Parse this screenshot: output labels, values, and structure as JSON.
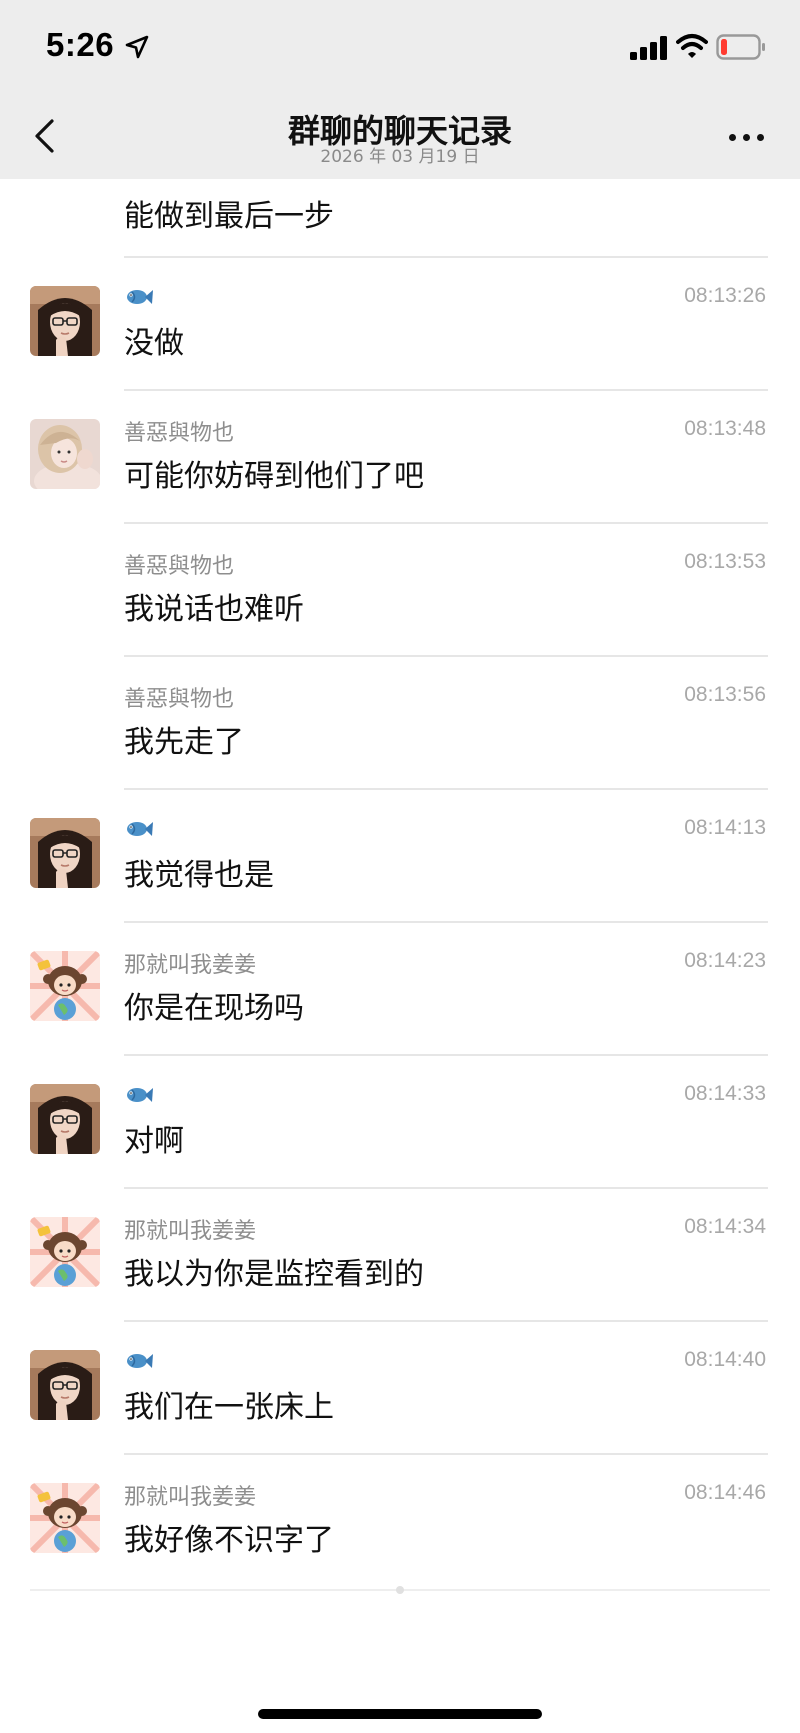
{
  "status_bar": {
    "time": "5:26"
  },
  "nav": {
    "title": "群聊的聊天记录",
    "date": "2026 年 03 月19 日"
  },
  "messages": [
    {
      "text": "能做到最后一步"
    },
    {
      "sender": "",
      "sender_icon": "fish-icon",
      "avatar": "glasses-girl-avatar",
      "time": "08:13:26",
      "text": "没做"
    },
    {
      "sender": "善惡與物也",
      "avatar": "blonde-girl-avatar",
      "time": "08:13:48",
      "text": "可能你妨碍到他们了吧"
    },
    {
      "sender": "善惡與物也",
      "time": "08:13:53",
      "text": "我说话也难听"
    },
    {
      "sender": "善惡與物也",
      "time": "08:13:56",
      "text": "我先走了"
    },
    {
      "sender": "",
      "sender_icon": "fish-icon",
      "avatar": "glasses-girl-avatar",
      "time": "08:14:13",
      "text": "我觉得也是"
    },
    {
      "sender": "那就叫我姜姜",
      "avatar": "cartoon-girl-avatar",
      "time": "08:14:23",
      "text": "你是在现场吗"
    },
    {
      "sender": "",
      "sender_icon": "fish-icon",
      "avatar": "glasses-girl-avatar",
      "time": "08:14:33",
      "text": "对啊"
    },
    {
      "sender": "那就叫我姜姜",
      "avatar": "cartoon-girl-avatar",
      "time": "08:14:34",
      "text": "我以为你是监控看到的"
    },
    {
      "sender": "",
      "sender_icon": "fish-icon",
      "avatar": "glasses-girl-avatar",
      "time": "08:14:40",
      "text": "我们在一张床上"
    },
    {
      "sender": "那就叫我姜姜",
      "avatar": "cartoon-girl-avatar",
      "time": "08:14:46",
      "text": "我好像不识字了"
    }
  ],
  "colors": {
    "header_bg": "#ededed",
    "divider": "#e6e6e6",
    "meta_text": "#8e8e8e",
    "battery_low": "#ff3b30"
  }
}
